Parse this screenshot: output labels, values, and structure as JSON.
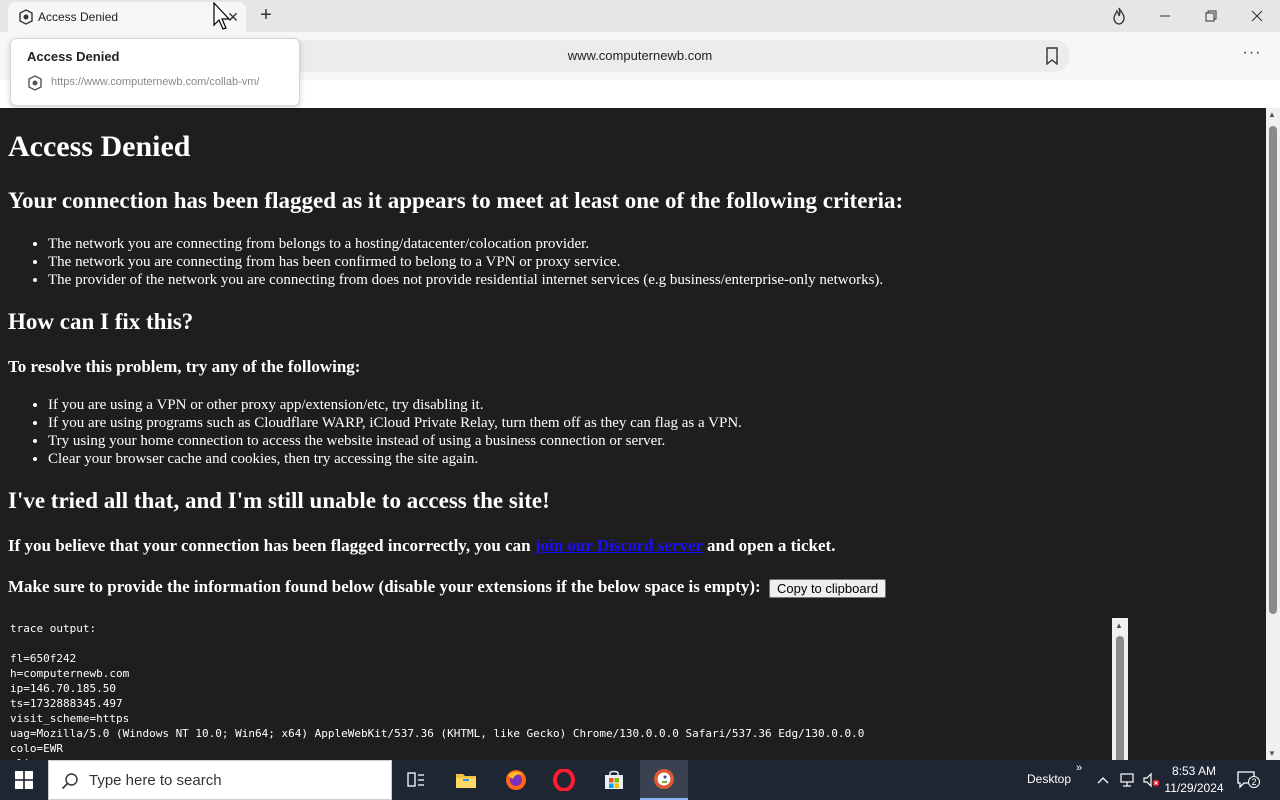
{
  "browser": {
    "tab_title": "Access Denied",
    "tab_close": "✕",
    "new_tab": "+",
    "address": "www.computernewb.com",
    "more": "···",
    "tooltip_title": "Access Denied",
    "tooltip_url": "https://www.computernewb.com/collab-vm/"
  },
  "page": {
    "h1": "Access Denied",
    "h2_criteria": "Your connection has been flagged as it appears to meet at least one of the following criteria:",
    "criteria": [
      "The network you are connecting from belongs to a hosting/datacenter/colocation provider.",
      "The network you are connecting from has been confirmed to belong to a VPN or proxy service.",
      "The provider of the network you are connecting from does not provide residential internet services (e.g business/enterprise-only networks)."
    ],
    "h2_fix": "How can I fix this?",
    "h4_resolve": "To resolve this problem, try any of the following:",
    "fixes": [
      "If you are using a VPN or other proxy app/extension/etc, try disabling it.",
      "If you are using programs such as Cloudflare WARP, iCloud Private Relay, turn them off as they can flag as a VPN.",
      "Try using your home connection to access the website instead of using a business connection or server.",
      "Clear your browser cache and cookies, then try accessing the site again."
    ],
    "h2_tried": "I've tried all that, and I'm still unable to access the site!",
    "incorrect_prefix": "If you believe that your connection has been flagged incorrectly, you can ",
    "incorrect_link": "join our Discord server",
    "incorrect_suffix": " and open a ticket.",
    "provide_info": "Make sure to provide the information found below (disable your extensions if the below space is empty):",
    "copy_button": "Copy to clipboard",
    "trace": "trace output:\n\nfl=650f242\nh=computernewb.com\nip=146.70.185.50\nts=1732888345.497\nvisit_scheme=https\nuag=Mozilla/5.0 (Windows NT 10.0; Win64; x64) AppleWebKit/537.36 (KHTML, like Gecko) Chrome/130.0.0.0 Safari/537.36 Edg/130.0.0.0\ncolo=EWR\nsliver=none"
  },
  "taskbar": {
    "search_placeholder": "Type here to search",
    "desktop_label": "Desktop",
    "time": "8:53 AM",
    "date": "11/29/2024",
    "notification_count": "2"
  },
  "colors": {
    "page_bg": "#1e1e1e",
    "link": "#1a0dff",
    "taskbar_bg": "#1f2633"
  }
}
